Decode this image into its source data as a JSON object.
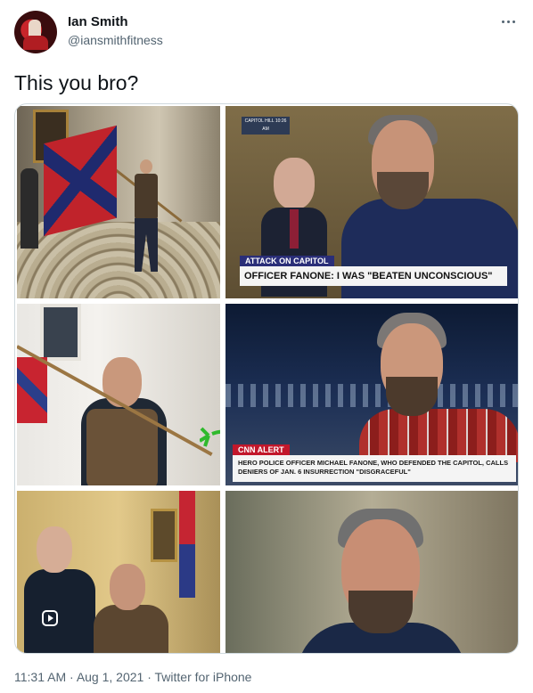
{
  "author": {
    "display_name": "Ian Smith",
    "handle": "@iansmithfitness",
    "avatar_icon": "profile-avatar"
  },
  "more_icon": "more-options-icon",
  "tweet": {
    "text": "This you bro?"
  },
  "media": {
    "photo2_chyron": {
      "clock": "CAPITOL HILL\n10:26 AM",
      "tag": "ATTACK ON CAPITOL",
      "headline": "OFFICER FANONE: I WAS \"BEATEN UNCONSCIOUS\""
    },
    "photo4_chyron": {
      "tag": "CNN ALERT",
      "headline": "HERO POLICE OFFICER MICHAEL FANONE, WHO DEFENDED THE CAPITOL, CALLS DENIERS OF JAN. 6 INSURRECTION \"DISGRACEFUL\""
    },
    "frog_icon": "green-frog-sticker",
    "reel_icon": "video-reel-icon"
  },
  "footer": {
    "time": "11:31 AM",
    "separator": "·",
    "date": "Aug 1, 2021",
    "source": "Twitter for iPhone"
  },
  "colors": {
    "text": "#0f1419",
    "secondary": "#536471",
    "border": "#cfd9de"
  }
}
